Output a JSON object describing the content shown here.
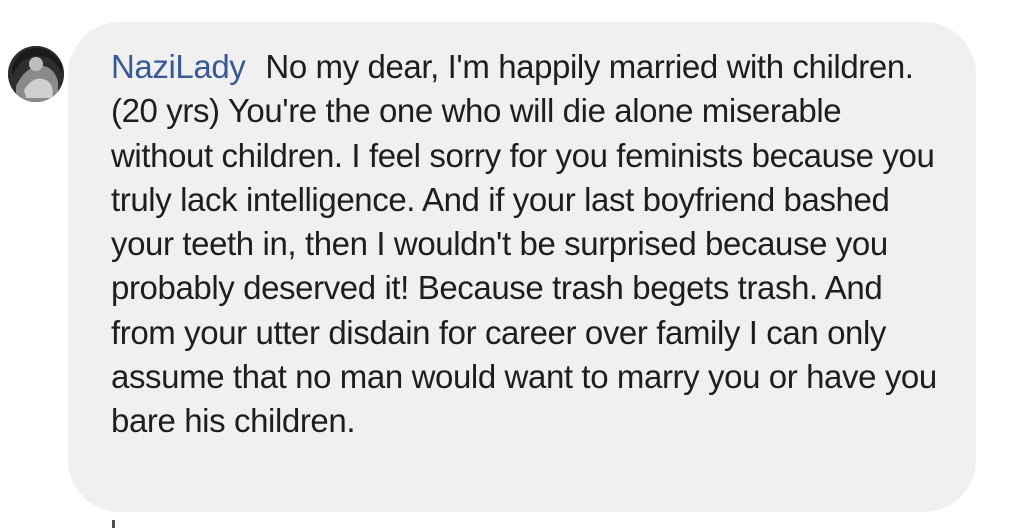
{
  "comment": {
    "author": "NaziLady",
    "text": "No my dear, I'm happily married with children. (20 yrs) You're the one who will die alone miserable without children. I feel sorry for you feminists because you truly lack intelligence. And if your last boyfriend bashed your teeth in, then I wouldn't be surprised because you probably deserved it! Because trash begets trash. And from your utter disdain for career over family I can only assume that no man would want to marry you or have you bare his children.",
    "avatar_icon": "profile-photo"
  },
  "colors": {
    "bubble_background": "#f0f0f0",
    "author_link": "#385898",
    "text": "#1c1e21"
  }
}
